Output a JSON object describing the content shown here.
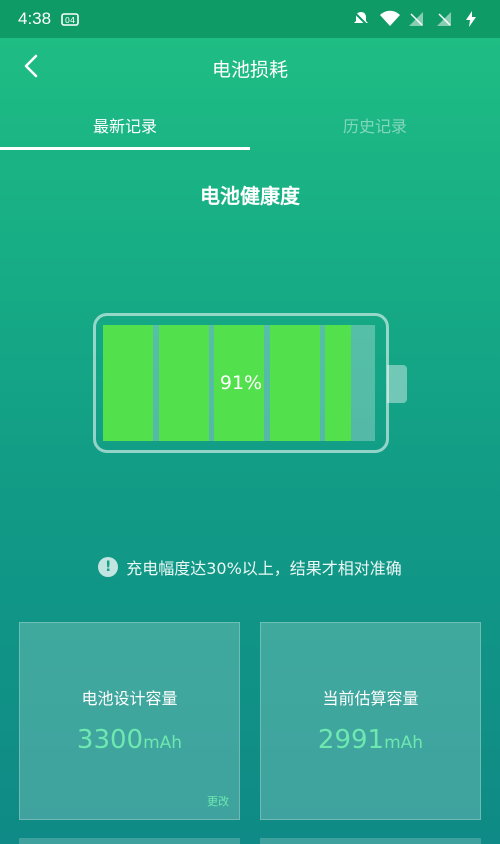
{
  "status_bar": {
    "time": "4:38",
    "icons": [
      "notification-icon",
      "bell-off-icon",
      "wifi-icon",
      "signal-off-icon",
      "signal-off-icon",
      "charging-icon"
    ]
  },
  "header": {
    "title": "电池损耗",
    "back_icon": "back-arrow-icon"
  },
  "tabs": [
    {
      "label": "最新记录",
      "active": true
    },
    {
      "label": "历史记录",
      "active": false
    }
  ],
  "section": {
    "title": "电池健康度"
  },
  "battery": {
    "percent_label": "91%",
    "health_fraction": 0.91,
    "fill_color": "#52e14d"
  },
  "notice": {
    "icon": "exclamation-icon",
    "text": "充电幅度达30%以上，结果才相对准确"
  },
  "cards": [
    {
      "label": "电池设计容量",
      "value": "3300",
      "unit": "mAh",
      "action": "更改"
    },
    {
      "label": "当前估算容量",
      "value": "2991",
      "unit": "mAh"
    }
  ],
  "colors": {
    "accent_green": "#6ee8b0",
    "battery_green": "#52e14d",
    "status_bar": "#0f9b66"
  }
}
